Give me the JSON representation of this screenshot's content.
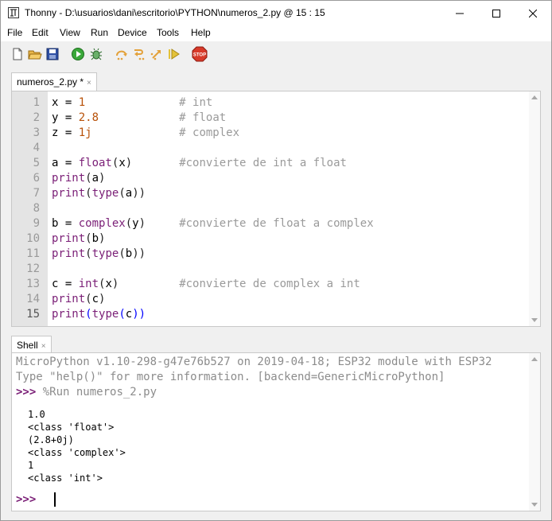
{
  "window": {
    "title": "Thonny  -  D:\\usuarios\\dani\\escritorio\\PYTHON\\numeros_2.py  @  15 : 15",
    "minimize_glyph": "—",
    "maximize_glyph": "☐",
    "close_glyph": "✕"
  },
  "menu": {
    "items": [
      "File",
      "Edit",
      "View",
      "Run",
      "Device",
      "Tools",
      "Help"
    ]
  },
  "toolbar": {
    "icons": [
      "new-file",
      "open-file",
      "save-file",
      "run",
      "debug",
      "step-over",
      "step-into",
      "step-out",
      "resume",
      "stop"
    ],
    "stop_label": "STOP"
  },
  "editor": {
    "tab_label": "numeros_2.py *",
    "tab_close": "×",
    "current_line": 15,
    "lines": [
      {
        "n": "1",
        "code": "x = 1              # int"
      },
      {
        "n": "2",
        "code": "y = 2.8            # float"
      },
      {
        "n": "3",
        "code": "z = 1j             # complex"
      },
      {
        "n": "4",
        "code": ""
      },
      {
        "n": "5",
        "code": "a = float(x)       #convierte de int a float"
      },
      {
        "n": "6",
        "code": "print(a)"
      },
      {
        "n": "7",
        "code": "print(type(a))"
      },
      {
        "n": "8",
        "code": ""
      },
      {
        "n": "9",
        "code": "b = complex(y)     #convierte de float a complex"
      },
      {
        "n": "10",
        "code": "print(b)"
      },
      {
        "n": "11",
        "code": "print(type(b))"
      },
      {
        "n": "12",
        "code": ""
      },
      {
        "n": "13",
        "code": "c = int(x)         #convierte de complex a int"
      },
      {
        "n": "14",
        "code": "print(c)"
      },
      {
        "n": "15",
        "code": "print(type(c))"
      }
    ]
  },
  "shell": {
    "tab_label": "Shell",
    "tab_close": "×",
    "banner_1": "MicroPython v1.10-298-g47e76b527 on 2019-04-18; ESP32 module with ESP32",
    "banner_2": "Type \"help()\" for more information. [backend=GenericMicroPython]",
    "prompt": ">>>",
    "command": " %Run numeros_2.py",
    "output": [
      "1.0",
      "<class 'float'>",
      "(2.8+0j)",
      "<class 'complex'>",
      "1",
      "<class 'int'>"
    ],
    "final_prompt": ">>>"
  },
  "colors": {
    "number": "#b8520a",
    "comment": "#9a9a9a",
    "builtin": "#7a1e76",
    "prompt": "#7a1e76",
    "gutter": "#e4e4e4"
  }
}
